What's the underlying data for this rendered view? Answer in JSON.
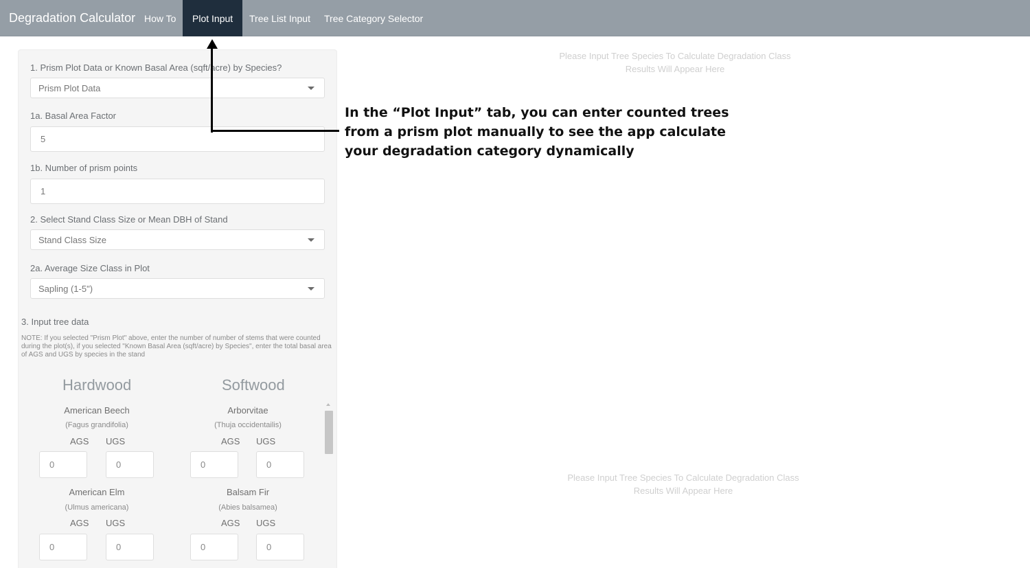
{
  "navbar": {
    "brand": "Degradation Calculator",
    "tabs": [
      {
        "label": "How To",
        "active": false
      },
      {
        "label": "Plot Input",
        "active": true
      },
      {
        "label": "Tree List Input",
        "active": false
      },
      {
        "label": "Tree Category Selector",
        "active": false
      }
    ]
  },
  "sidebar": {
    "q1_label": "1. Prism Plot Data or Known Basal Area (sqft/acre) by Species?",
    "q1_value": "Prism Plot Data",
    "q1a_label": "1a. Basal Area Factor",
    "q1a_value": "5",
    "q1b_label": "1b. Number of prism points",
    "q1b_value": "1",
    "q2_label": "2. Select Stand Class Size or Mean DBH of Stand",
    "q2_value": "Stand Class Size",
    "q2a_label": "2a. Average Size Class in Plot",
    "q2a_value": "Sapling (1-5\")",
    "q3_label": "3. Input tree data",
    "note": "NOTE: If you selected \"Prism Plot\" above, enter the number of number of stems that were counted during the plot(s), if you selected \"Known Basal Area (sqft/acre) by Species\", enter the total basal area of AGS and UGS by species in the stand",
    "hardwood_heading": "Hardwood",
    "softwood_heading": "Softwood",
    "ags_label": "AGS",
    "ugs_label": "UGS",
    "species": [
      {
        "name": "American Beech",
        "latin": "(Fagus grandifolia)",
        "ags": "0",
        "ugs": "0"
      },
      {
        "name": "Arborvitae",
        "latin": "(Thuja occidentailis)",
        "ags": "0",
        "ugs": "0"
      },
      {
        "name": "American Elm",
        "latin": "(Ulmus americana)",
        "ags": "0",
        "ugs": "0"
      },
      {
        "name": "Balsam Fir",
        "latin": "(Abies balsamea)",
        "ags": "0",
        "ugs": "0"
      }
    ]
  },
  "main": {
    "placeholder_1_line1": "Please Input Tree Species To Calculate Degradation Class",
    "placeholder_1_line2": "Results Will Appear Here",
    "placeholder_2_line1": "Please Input Tree Species To Calculate Degradation Class",
    "placeholder_2_line2": "Results Will Appear Here"
  },
  "annotation": {
    "line1": "In the “Plot Input” tab, you can enter counted trees",
    "line2": "from a prism plot manually to see the app calculate",
    "line3": "your degradation category dynamically"
  }
}
